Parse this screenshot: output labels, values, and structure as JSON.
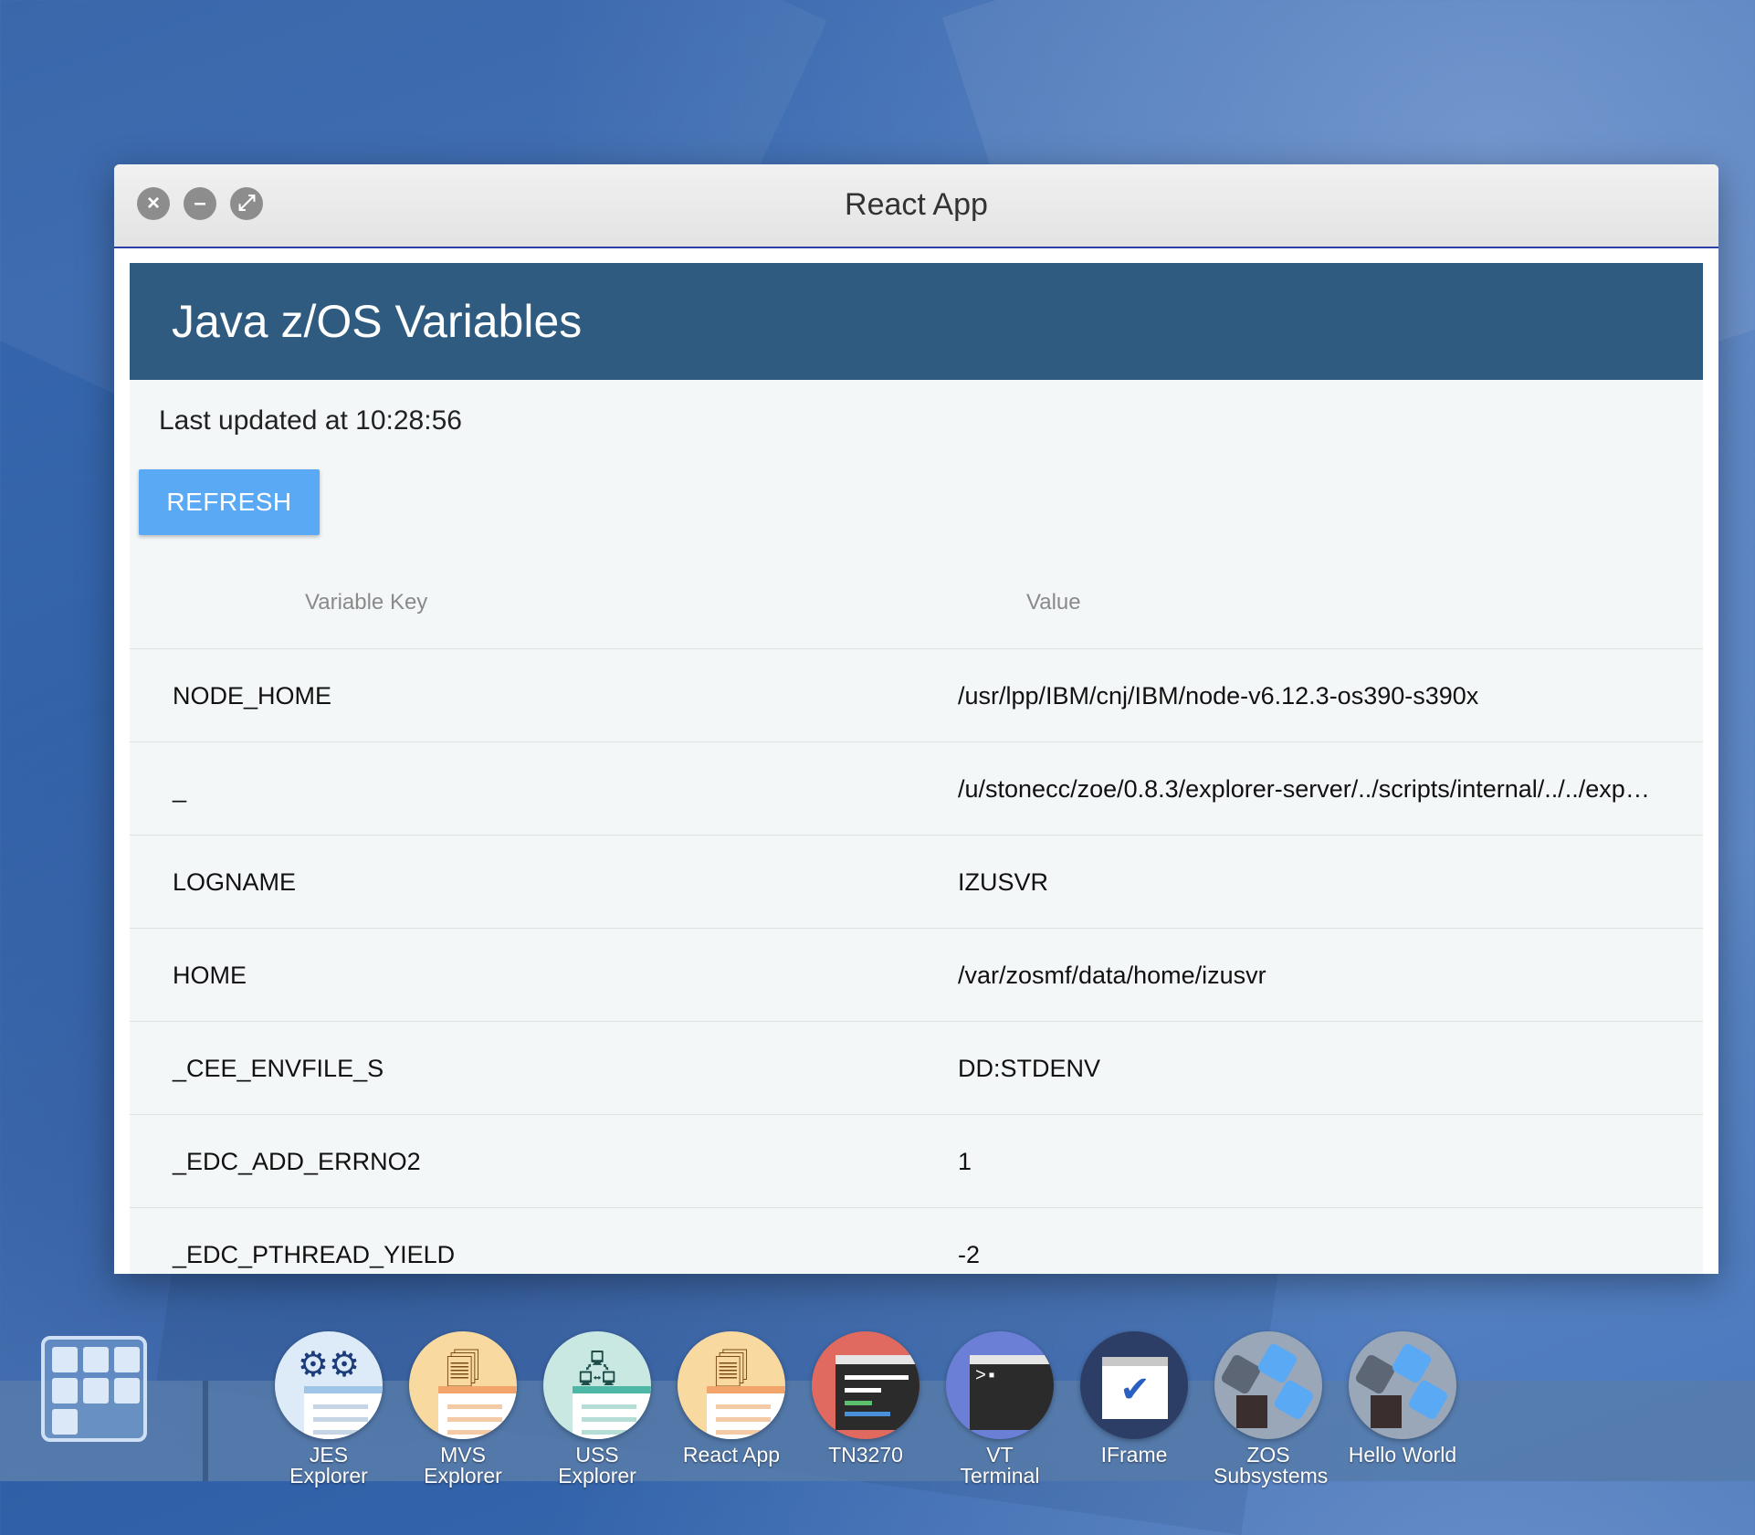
{
  "window": {
    "title": "React App",
    "controls": {
      "close_icon": "close-icon",
      "minimize_icon": "minimize-icon",
      "maximize_icon": "maximize-icon"
    }
  },
  "app": {
    "title": "Java z/OS Variables",
    "last_updated": "Last updated at 10:28:56",
    "refresh_label": "REFRESH"
  },
  "table": {
    "headers": {
      "key": "Variable Key",
      "value": "Value"
    },
    "rows": [
      {
        "key": "NODE_HOME",
        "value": "/usr/lpp/IBM/cnj/IBM/node-v6.12.3-os390-s390x"
      },
      {
        "key": "_",
        "value": "/u/stonecc/zoe/0.8.3/explorer-server/../scripts/internal/../../explor…"
      },
      {
        "key": "LOGNAME",
        "value": "IZUSVR"
      },
      {
        "key": "HOME",
        "value": "/var/zosmf/data/home/izusvr"
      },
      {
        "key": "_CEE_ENVFILE_S",
        "value": "DD:STDENV"
      },
      {
        "key": "_EDC_ADD_ERRNO2",
        "value": "1"
      },
      {
        "key": "_EDC_PTHREAD_YIELD",
        "value": "-2"
      }
    ]
  },
  "taskbar": {
    "launcher_icon": "app-grid-icon",
    "items": [
      {
        "label": "JES Explorer",
        "icon": "gears-icon",
        "color": "#dcebf7"
      },
      {
        "label": "MVS Explorer",
        "icon": "folder-doc-icon",
        "color": "#f8d9a0"
      },
      {
        "label": "USS Explorer",
        "icon": "tree-doc-icon",
        "color": "#c9e8e2"
      },
      {
        "label": "React App",
        "icon": "folder-doc-icon",
        "color": "#f8d9a0"
      },
      {
        "label": "TN3270",
        "icon": "terminal-icon",
        "color": "#e06a5f"
      },
      {
        "label": "VT Terminal",
        "icon": "terminal-prompt-icon",
        "color": "#6b7fd6"
      },
      {
        "label": "IFrame",
        "icon": "check-window-icon",
        "color": "#2c3e66"
      },
      {
        "label": "ZOS Subsystems",
        "icon": "hexagons-icon",
        "color": "#9aa7b8"
      },
      {
        "label": "Hello World",
        "icon": "hexagons-icon",
        "color": "#9aa7b8"
      }
    ]
  }
}
